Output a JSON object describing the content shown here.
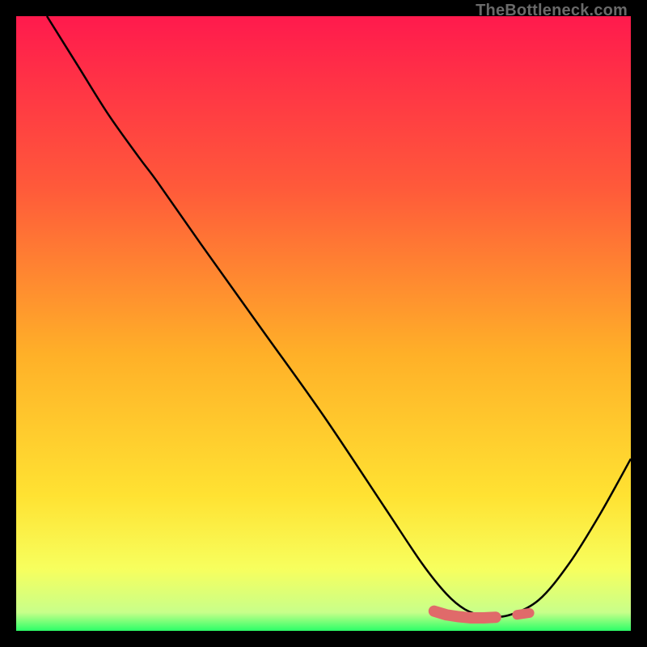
{
  "watermark": "TheBottleneck.com",
  "chart_data": {
    "type": "line",
    "title": "",
    "xlabel": "",
    "ylabel": "",
    "xlim": [
      0,
      100
    ],
    "ylim": [
      0,
      100
    ],
    "grid": false,
    "legend": false,
    "background_gradient": {
      "direction": "vertical",
      "stops": [
        {
          "offset": 0.0,
          "color": "#ff1a4d"
        },
        {
          "offset": 0.28,
          "color": "#ff5a3a"
        },
        {
          "offset": 0.55,
          "color": "#ffb028"
        },
        {
          "offset": 0.78,
          "color": "#ffe232"
        },
        {
          "offset": 0.9,
          "color": "#f7ff5e"
        },
        {
          "offset": 0.97,
          "color": "#c8ff8a"
        },
        {
          "offset": 1.0,
          "color": "#2cff68"
        }
      ]
    },
    "series": [
      {
        "name": "curve",
        "color": "#000000",
        "x": [
          5,
          10,
          15,
          20,
          23,
          30,
          40,
          50,
          60,
          66,
          70,
          73,
          76,
          80,
          85,
          90,
          95,
          100
        ],
        "y": [
          100,
          92,
          84,
          77,
          73,
          63,
          49,
          35,
          20,
          11,
          6,
          3.5,
          2.5,
          2.5,
          5,
          11,
          19,
          28
        ]
      }
    ],
    "annotations": {
      "valley_marker": {
        "color": "#e06a6a",
        "points": [
          {
            "x": 68,
            "y": 3.2
          },
          {
            "x": 70,
            "y": 2.6
          },
          {
            "x": 72,
            "y": 2.3
          },
          {
            "x": 74,
            "y": 2.1
          },
          {
            "x": 76,
            "y": 2.1
          },
          {
            "x": 78,
            "y": 2.2
          },
          {
            "x": 81.5,
            "y": 2.6
          },
          {
            "x": 83.5,
            "y": 2.9
          }
        ]
      }
    }
  }
}
